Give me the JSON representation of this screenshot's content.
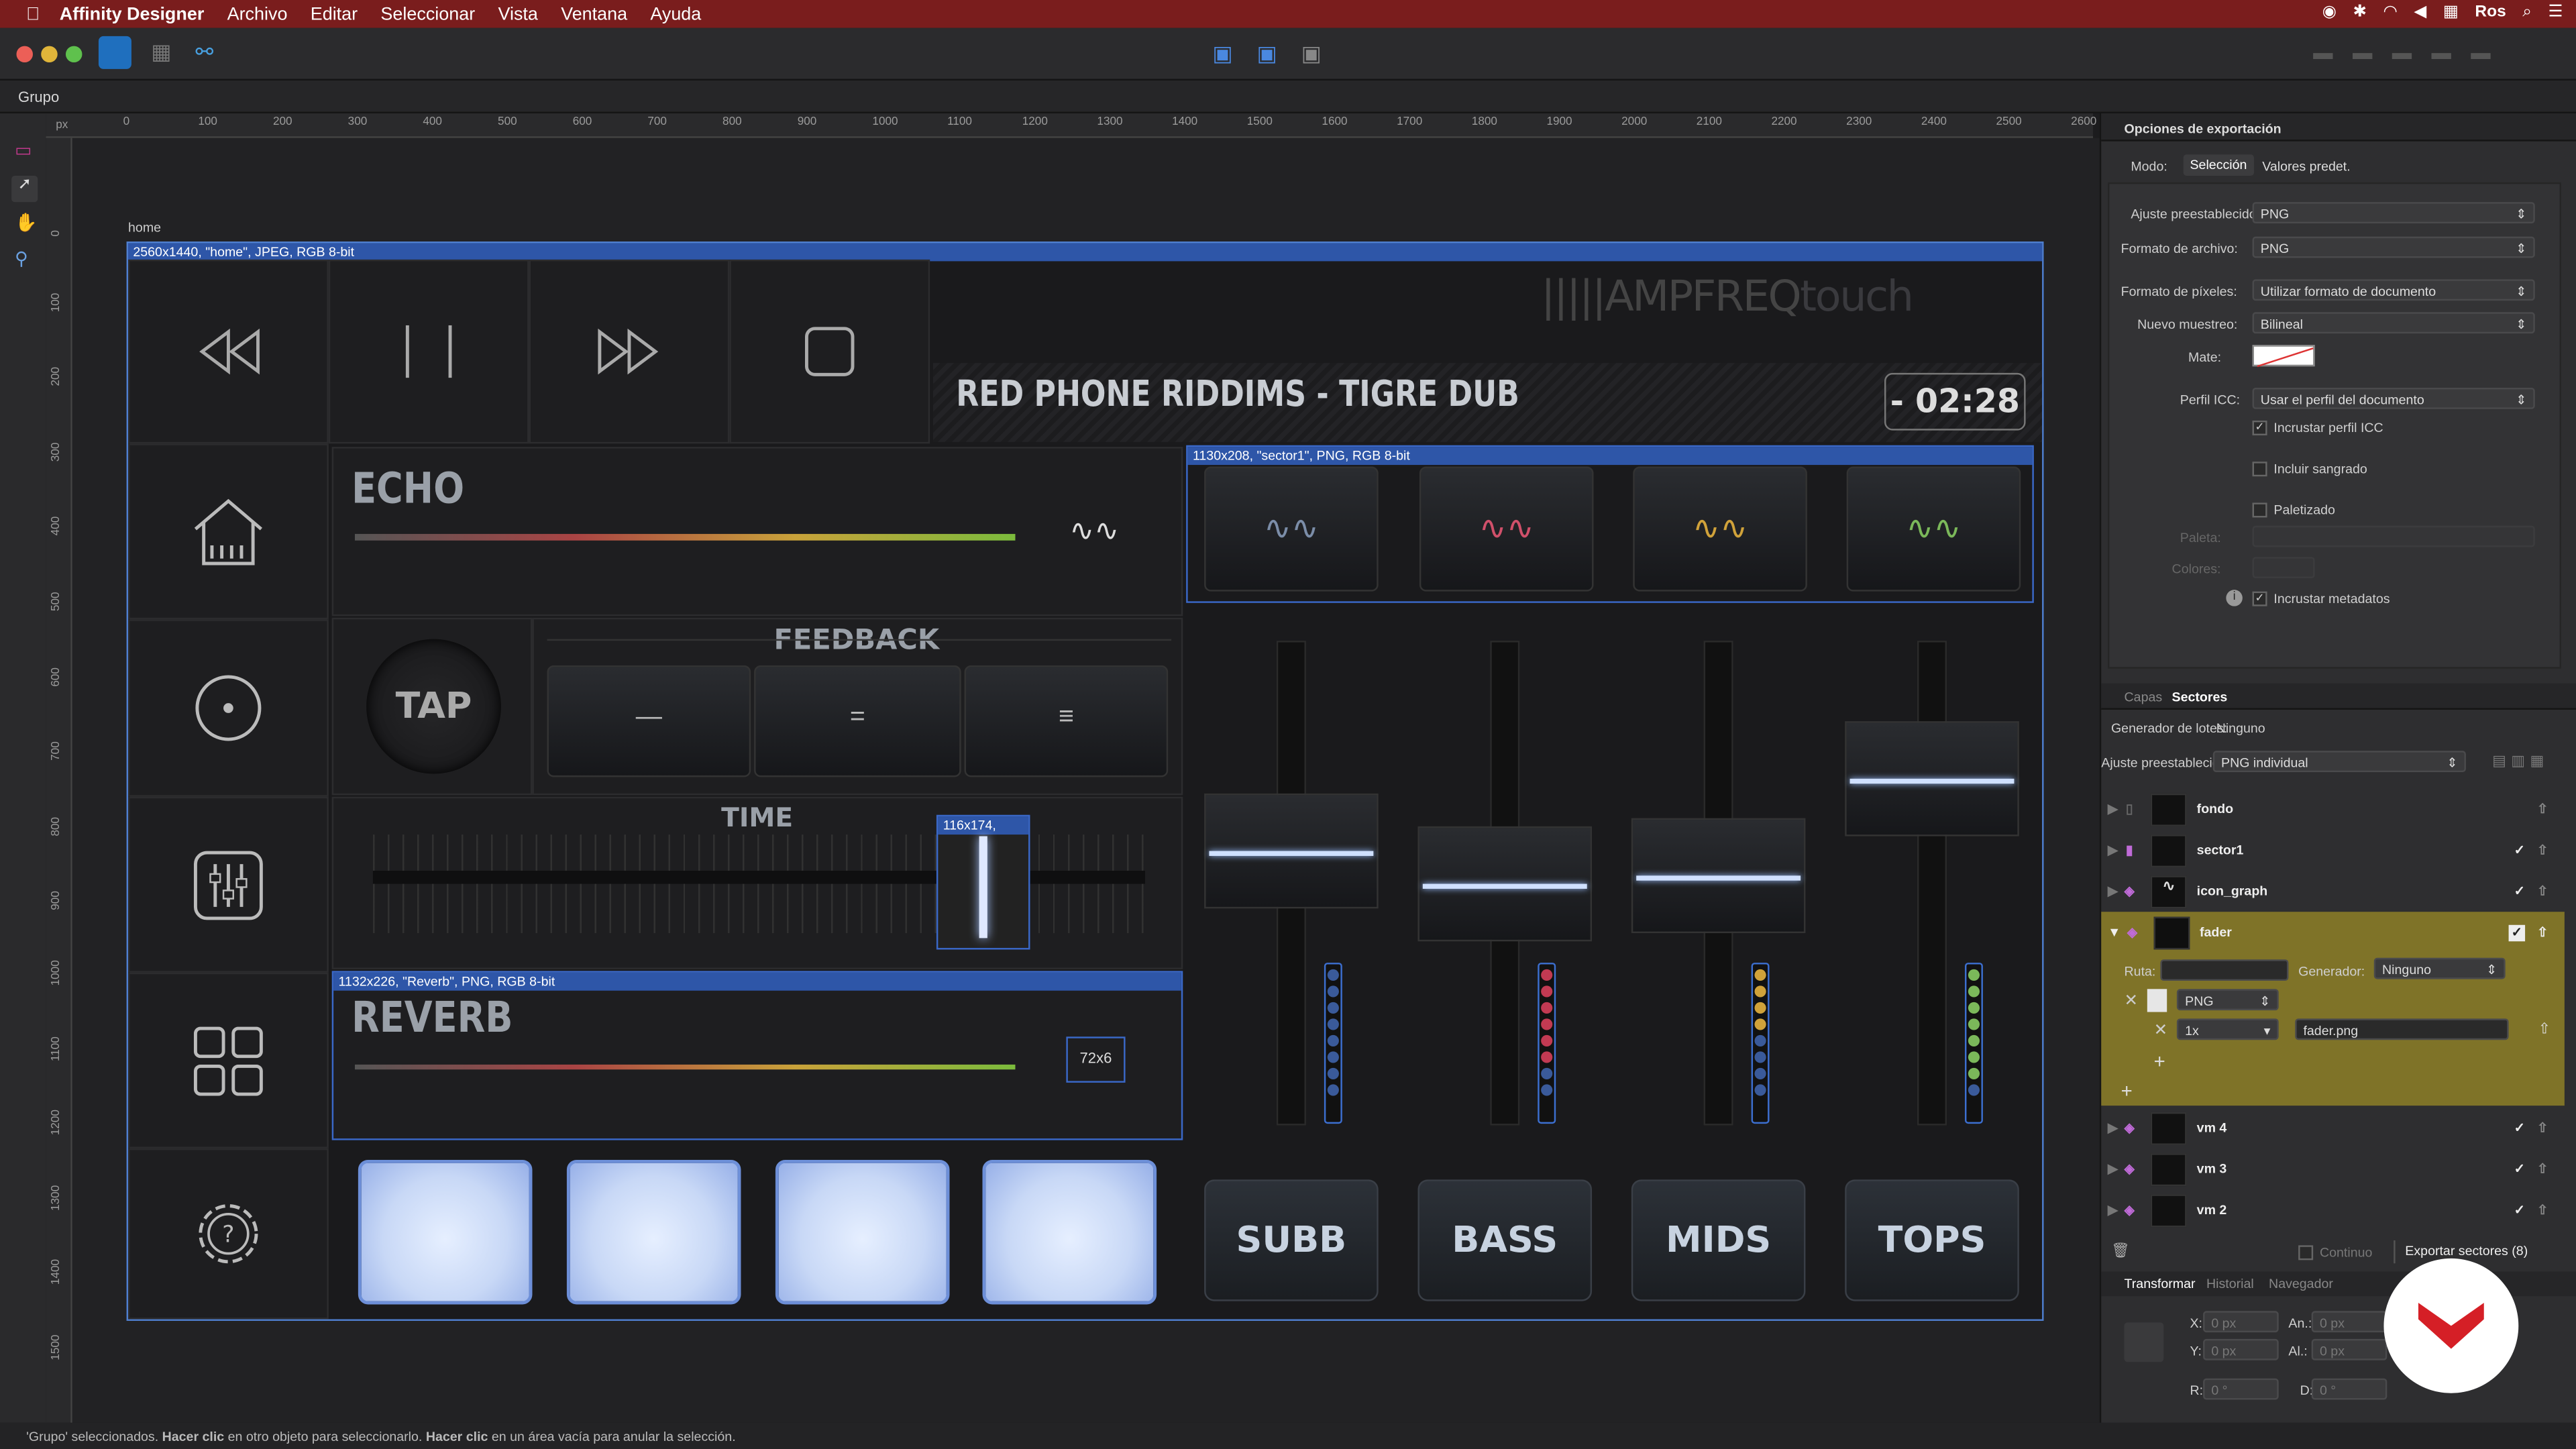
{
  "menubar": {
    "app": "Affinity Designer",
    "items": [
      "Archivo",
      "Editar",
      "Seleccionar",
      "Vista",
      "Ventana",
      "Ayuda"
    ],
    "user": "Ros"
  },
  "context": {
    "label": "Grupo"
  },
  "ruler": {
    "unit": "px",
    "h_ticks": [
      "0",
      "100",
      "200",
      "300",
      "400",
      "500",
      "600",
      "700",
      "800",
      "900",
      "1000",
      "1100",
      "1200",
      "1300",
      "1400",
      "1500",
      "1600",
      "1700",
      "1800",
      "1900",
      "2000",
      "2100",
      "2200",
      "2300",
      "2400",
      "2500",
      "2600"
    ],
    "v_ticks": [
      "0",
      "100",
      "200",
      "300",
      "400",
      "500",
      "600",
      "700",
      "800",
      "900",
      "1000",
      "1100",
      "1200",
      "1300",
      "1400",
      "1500"
    ]
  },
  "canvas": {
    "artboard_name": "home",
    "artboard_info": "2560x1440, \"home\", JPEG, RGB 8-bit",
    "logo_a": "AMPFREQ",
    "logo_b": "touch",
    "track_title": "RED PHONE RIDDIMS - TIGRE DUB",
    "time": "- 02:28",
    "echo": "ECHO",
    "feedback": "FEEDBACK",
    "tap": "TAP",
    "time_label": "TIME",
    "reverb": "REVERB",
    "sector1_info": "1130x208, \"sector1\", PNG, RGB 8-bit",
    "reverb_info": "1132x226, \"Reverb\", PNG, RGB 8-bit",
    "fader_info": "116x174,",
    "small_info": "72x6",
    "eq": [
      "SUBB",
      "BASS",
      "MIDS",
      "TOPS"
    ],
    "fader_levels": [
      0.55,
      0.48,
      0.5,
      0.7
    ]
  },
  "export": {
    "title": "Opciones de exportación",
    "mode_label": "Modo:",
    "mode_sel": "Selección",
    "mode_other": "Valores predet.",
    "preset_label": "Ajuste preestablecido:",
    "preset": "PNG",
    "format_label": "Formato de archivo:",
    "format": "PNG",
    "pixel_label": "Formato de píxeles:",
    "pixel": "Utilizar formato de documento",
    "resample_label": "Nuevo muestreo:",
    "resample": "Bilineal",
    "matte_label": "Mate:",
    "icc_label": "Perfil ICC:",
    "icc": "Usar el perfil del documento",
    "embed_icc": "Incrustar perfil ICC",
    "bleed": "Incluir sangrado",
    "palettized": "Paletizado",
    "palette_label": "Paleta:",
    "colors_label": "Colores:",
    "metadata": "Incrustar metadatos"
  },
  "slices": {
    "tab_layers": "Capas",
    "tab_slices": "Sectores",
    "batch_label": "Generador de lotes:",
    "batch": "Ninguno",
    "preset_label": "Ajuste preestablecido:",
    "preset": "PNG individual",
    "route_label": "Ruta:",
    "gen_label": "Generador:",
    "gen": "Ninguno",
    "fmt": "PNG",
    "scale": "1x",
    "file": "fader.png",
    "items": [
      "fondo",
      "sector1",
      "icon_graph",
      "fader",
      "vm 4",
      "vm 3",
      "vm 2"
    ],
    "continuous": "Continuo",
    "export_btn": "Exportar sectores (8)"
  },
  "transform": {
    "tabs": [
      "Transformar",
      "Historial",
      "Navegador"
    ],
    "x_label": "X:",
    "x": "0 px",
    "y_label": "Y:",
    "y": "0 px",
    "w_label": "An.:",
    "w": "0 px",
    "h_label": "Al.:",
    "h": "0 px",
    "r_label": "R:",
    "r": "0 °",
    "s_label": "D:",
    "s": "0 °"
  },
  "status": {
    "p1": "'Grupo' seleccionados. ",
    "b1": "Hacer clic",
    "p2": " en otro objeto para seleccionarlo. ",
    "b2": "Hacer clic",
    "p3": " en un área vacía para anular la selección."
  }
}
